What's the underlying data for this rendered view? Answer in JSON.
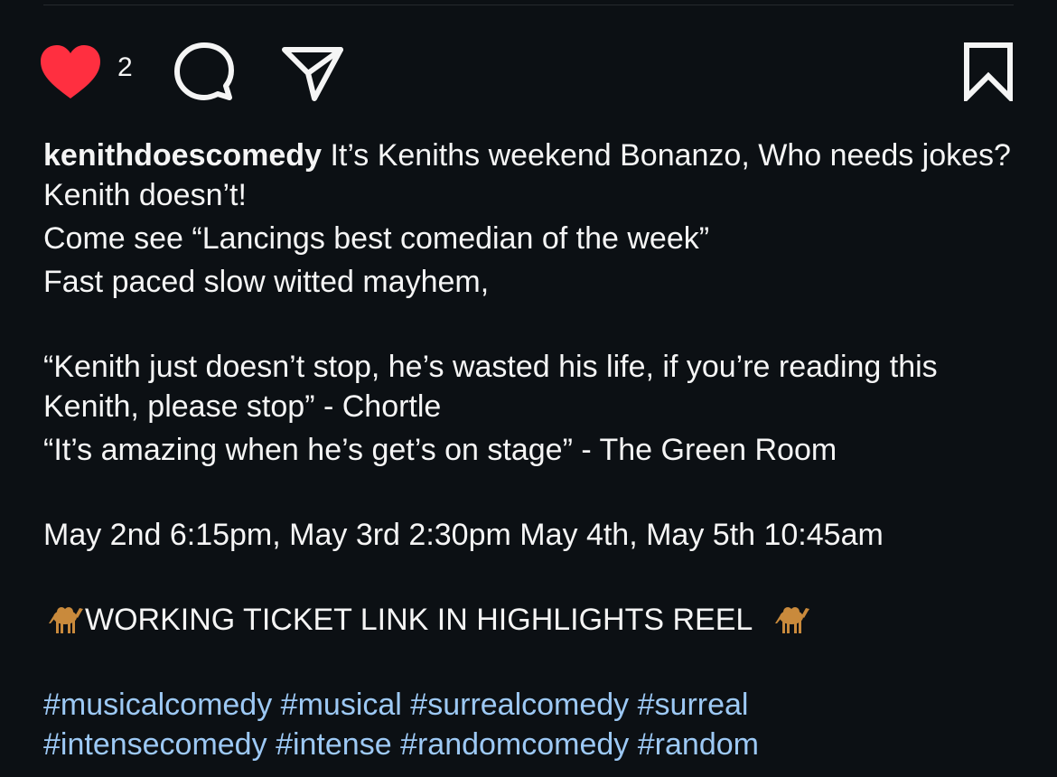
{
  "post": {
    "likes_count": "2",
    "caption": {
      "username": "kenithdoescomedy",
      "line1": "It’s Keniths weekend Bonanzo, Who needs jokes? Kenith doesn’t!",
      "line2": "Come see “Lancings best comedian of the week”",
      "line3": "Fast paced slow witted mayhem,",
      "quote1": "“Kenith just doesn’t stop, he’s wasted his life, if you’re reading this Kenith, please stop” - Chortle",
      "quote2": "“It’s amazing when he’s get’s on stage” - The Green Room",
      "dates": "May 2nd 6:15pm, May 3rd 2:30pm May 4th, May 5th 10:45am",
      "ticket": "WORKING TICKET LINK IN HIGHLIGHTS REEL",
      "hashtags_row1": [
        "#musicalcomedy",
        "#musical",
        "#surrealcomedy",
        "#surreal"
      ],
      "hashtags_row2": [
        "#intensecomedy",
        "#intense",
        "#randomcomedy",
        "#random"
      ]
    }
  },
  "icons": {
    "like": "heart-icon",
    "comment": "comment-icon",
    "share": "share-icon",
    "save": "bookmark-icon",
    "emoji": "camel-emoji"
  },
  "colors": {
    "background": "#0c1014",
    "text": "#f5f5f5",
    "like": "#ff2f40",
    "hashtag": "#9dc9f5"
  }
}
